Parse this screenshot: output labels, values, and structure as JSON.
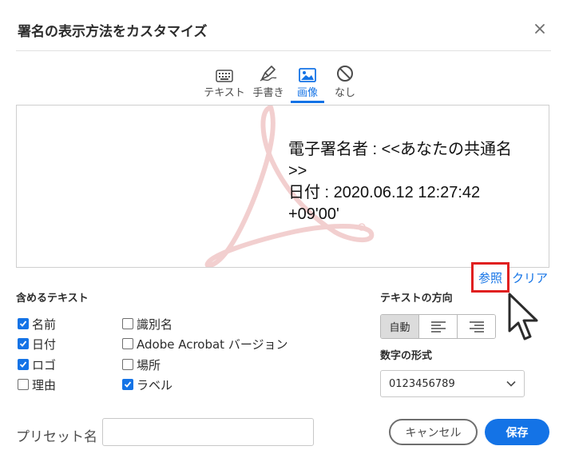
{
  "dialog": {
    "title": "署名の表示方法をカスタマイズ"
  },
  "tabs": [
    {
      "label": "テキスト",
      "icon": "keyboard-icon",
      "active": false
    },
    {
      "label": "手書き",
      "icon": "pen-icon",
      "active": false
    },
    {
      "label": "画像",
      "icon": "image-icon",
      "active": true
    },
    {
      "label": "なし",
      "icon": "no-symbol-icon",
      "active": false
    }
  ],
  "preview": {
    "lines": [
      "電子署名者 : <<あなたの共通名",
      ">>",
      "日付 : 2020.06.12 12:27:42",
      "+09'00'"
    ],
    "watermark_color": "#f2cfcf"
  },
  "image_actions": {
    "browse_label": "参照",
    "clear_label": "クリア"
  },
  "include_text": {
    "title": "含めるテキスト",
    "options": [
      {
        "label": "名前",
        "checked": true
      },
      {
        "label": "日付",
        "checked": true
      },
      {
        "label": "ロゴ",
        "checked": true
      },
      {
        "label": "理由",
        "checked": false
      },
      {
        "label": "識別名",
        "checked": false
      },
      {
        "label": "Adobe Acrobat バージョン",
        "checked": false
      },
      {
        "label": "場所",
        "checked": false
      },
      {
        "label": "ラベル",
        "checked": true
      }
    ]
  },
  "text_direction": {
    "title": "テキストの方向",
    "auto_label": "自動",
    "selected": "自動"
  },
  "number_format": {
    "title": "数字の形式",
    "value": "0123456789"
  },
  "preset": {
    "label": "プリセット名",
    "value": ""
  },
  "buttons": {
    "cancel_label": "キャンセル",
    "save_label": "保存"
  },
  "colors": {
    "accent": "#1473e6",
    "highlight_box": "#e02020"
  }
}
